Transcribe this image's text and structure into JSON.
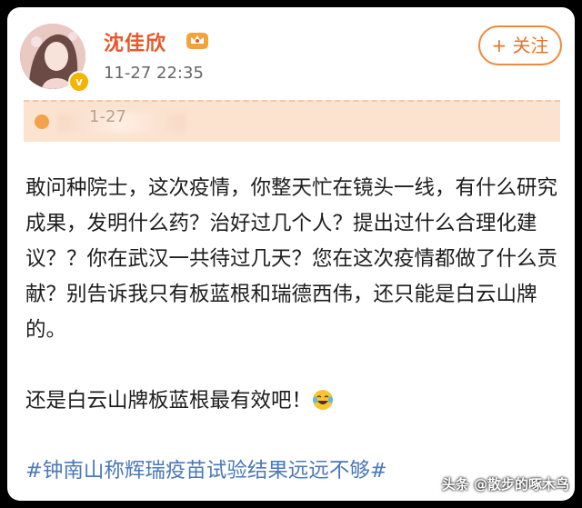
{
  "user": {
    "name": "沈佳欣",
    "time": "11-27 22:35"
  },
  "follow_button": "+ 关注",
  "repost": {
    "date_fragment": "1-27"
  },
  "post": {
    "paragraph1": "敢问种院士，这次疫情，你整天忙在镜头一线，有什么研究成果，发明什么药？治好过几个人？提出过什么合理化建议？？你在武汉一共待过几天？您在这次疫情都做了什么贡献？别告诉我只有板蓝根和瑞德西伟，还只能是白云山牌的。",
    "paragraph2": "还是白云山牌板蓝根最有效吧！",
    "hashtag": "#钟南山称辉瑞疫苗试验结果远远不够#"
  },
  "watermark": "头条 @散步的啄木鸟",
  "colors": {
    "name": "#e8572a",
    "follow": "#e8732a",
    "hashtag": "#4a78b8",
    "repost_bg": "#fbe3d0"
  },
  "icons": [
    "verified-badge-icon",
    "crown-member-icon",
    "laughing-tears-emoji-icon",
    "repost-dot-icon"
  ]
}
